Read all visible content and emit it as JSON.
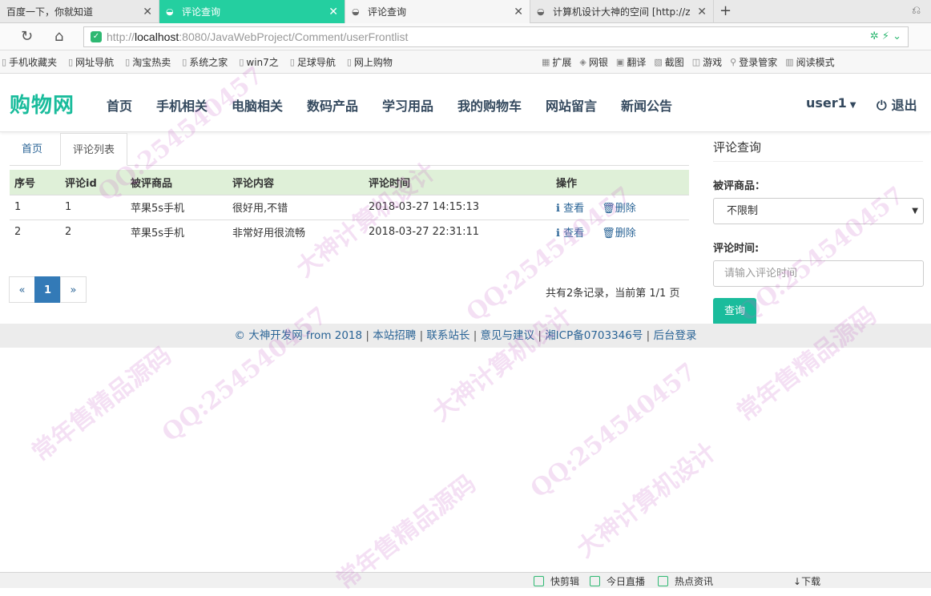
{
  "browser": {
    "tabs": [
      {
        "label": "百度一下，你就知道"
      },
      {
        "label": "评论查询"
      },
      {
        "label": "评论查询"
      },
      {
        "label": "计算机设计大神的空间 [http://z"
      }
    ],
    "url_prefix": "http://",
    "url_host": "localhost",
    "url_rest": ":8080/JavaWebProject/Comment/userFrontlist",
    "bookmarks": [
      "手机收藏夹",
      "网址导航",
      "淘宝热卖",
      "系统之家",
      "win7之",
      "足球导航",
      "网上购物"
    ],
    "toolbar": [
      "扩展",
      "网银",
      "翻译",
      "截图",
      "游戏",
      "登录管家",
      "阅读模式"
    ]
  },
  "site": {
    "brand": "购物网",
    "nav": [
      "首页",
      "手机相关",
      "电脑相关",
      "数码产品",
      "学习用品",
      "我的购物车",
      "网站留言",
      "新闻公告"
    ],
    "user": "user1",
    "logout": "退出"
  },
  "main": {
    "tabs": [
      "首页",
      "评论列表"
    ],
    "columns": [
      "序号",
      "评论id",
      "被评商品",
      "评论内容",
      "评论时间",
      "操作"
    ],
    "rows": [
      {
        "no": "1",
        "id": "1",
        "product": "苹果5s手机",
        "content": "很好用,不错",
        "time": "2018-03-27 14:15:13"
      },
      {
        "no": "2",
        "id": "2",
        "product": "苹果5s手机",
        "content": "非常好用很流畅",
        "time": "2018-03-27 22:31:11"
      }
    ],
    "action_view": "查看",
    "action_delete": "删除",
    "pager": {
      "prev": "«",
      "current": "1",
      "next": "»"
    },
    "page_info": "共有2条记录，当前第 1/1 页"
  },
  "sidebar": {
    "title": "评论查询",
    "product_label": "被评商品：",
    "product_value": "不限制",
    "time_label": "评论时间:",
    "time_placeholder": "请输入评论时间",
    "query_button": "查询"
  },
  "footer": {
    "links": [
      "© 大神开发网 from 2018",
      "本站招聘",
      "联系站长",
      "意见与建议",
      "湘ICP备0703346号",
      "后台登录"
    ]
  },
  "statusbar": [
    "快剪辑",
    "今日直播",
    "热点资讯",
    "下载"
  ],
  "watermarks": [
    "QQ:254540457",
    "大神计算机设计",
    "常年售精品源码"
  ],
  "colors": {
    "accent": "#1abc9c",
    "tab_active": "#24cfa0",
    "link": "#2a6496",
    "header_row": "#dff0d8",
    "pager_active": "#337ab7"
  }
}
